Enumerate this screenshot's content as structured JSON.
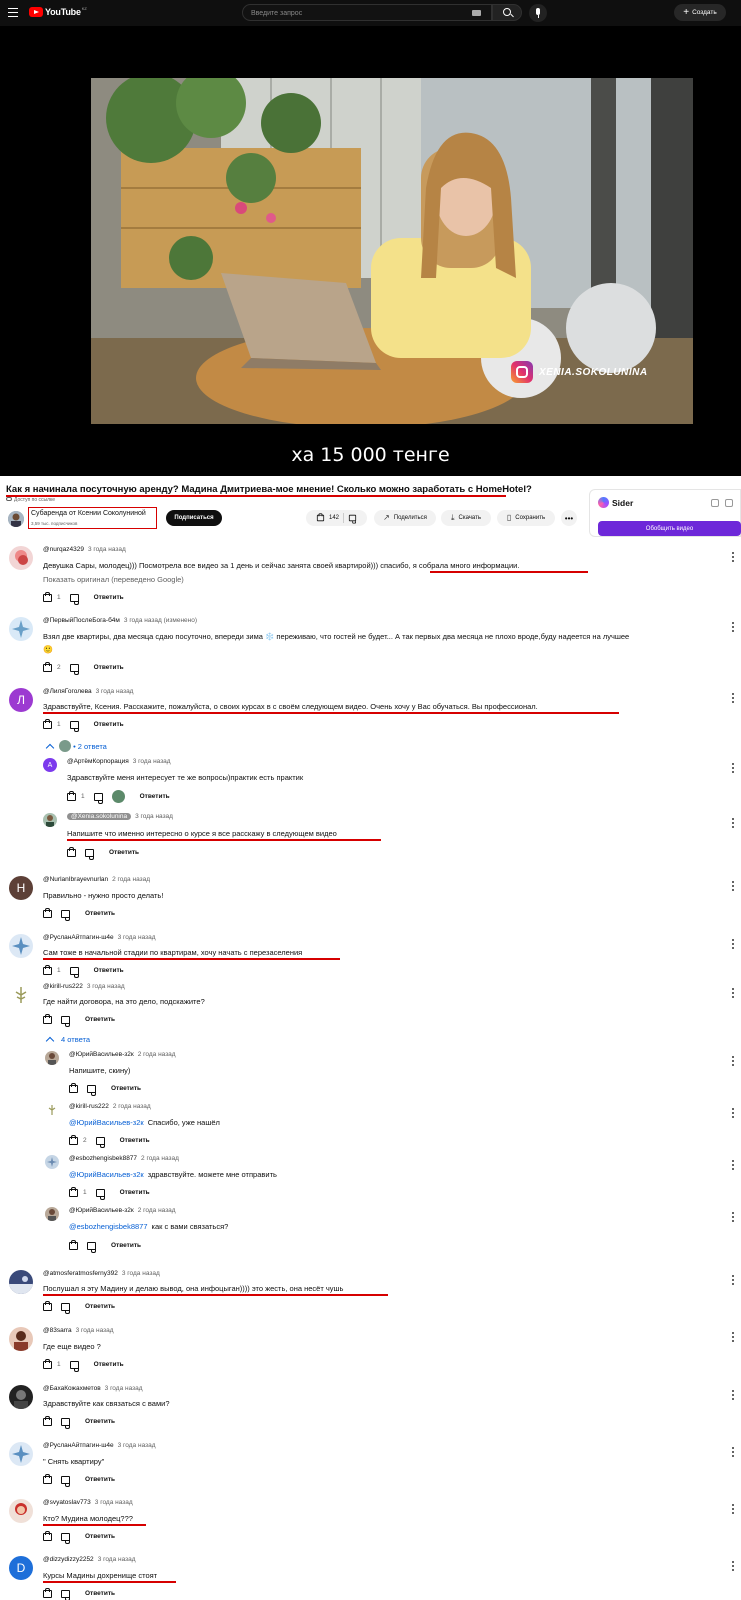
{
  "header": {
    "logo_text": "YouTube",
    "country_code": "KZ",
    "search_placeholder": "Введите запрос",
    "create_label": "Создать"
  },
  "video": {
    "subtitle": "ха 15 000 тенге",
    "watermark": "XENIA.SOKOLUNINA",
    "title": "Как я начинала посуточную аренду? Мадина Дмитриева-мое мнение! Сколько можно заработать с HomeHotel?",
    "access_note": "Доступ по ссылке",
    "channel_name": "Субаренда от Ксении Соколуниной",
    "channel_subs": "3,59 тыс. подписчиков",
    "subscribe_label": "Подписаться",
    "like_count": "142",
    "share_label": "Поделиться",
    "download_label": "Скачать",
    "save_label": "Сохранить"
  },
  "sider": {
    "name": "Sider",
    "button_label": "Обобщить видео"
  },
  "reply_label": "Ответить",
  "comments": [
    {
      "author": "@nurqaz4329",
      "time": "3 года назад",
      "text_a": "Девушка Сары, молодец))) Посмотрела все видео за 1 день и сейчас занята своей квартирой))) ",
      "text_b": "спасибо, я собрала много информации.",
      "translate": "Показать оригинал (переведено Google)",
      "likes": "1"
    },
    {
      "author": "@ПервыйПослеБога-б4м",
      "time": "3 года назад",
      "edited": "(изменено)",
      "text": "Взял две квартиры, два месяца сдаю посуточно, впереди зима ❄️ переживаю, что гостей не будет... А так первых два месяца не плохо вроде,буду надеется на лучшее",
      "emoji": "🙂",
      "likes": "2"
    },
    {
      "author": "@ЛиляГоголева",
      "time": "3 года назад",
      "avatar_letter": "Л",
      "text": "Здравствуйте, Ксения. Расскажите, пожалуйста, о своих курсах в с своём  следующем  видео. Очень  хочу  у Вас  обучаться. Вы профессионал.",
      "likes": "1",
      "replies_label": "2 ответа"
    },
    {
      "author": "@АртёмКорпорация",
      "time": "3 года назад",
      "avatar_letter": "А",
      "text": "Здравствуйте меня интересует те же вопросы)практик есть практик",
      "likes": "1"
    },
    {
      "author": "@Xenia.sokolunina",
      "time": "3 года назад",
      "text": "Напишите что именно интересно о курсе я все расскажу в следующем видео"
    },
    {
      "author": "@NurlanIbrayevnurlan",
      "time": "2 года назад",
      "avatar_letter": "Н",
      "text": "Правильно - нужно просто делать!"
    },
    {
      "author": "@РусланАйтпагин-ш4е",
      "time": "3 года назад",
      "text": "Сам тоже в начальной стадии по квартирам, хочу начать с перезаселения",
      "likes": "1"
    },
    {
      "author": "@kirill-rus222",
      "time": "3 года назад",
      "text": "Где найти договора, на это дело, подскажите?",
      "replies_label": "4 ответа"
    },
    {
      "author": "@ЮрийВасильев-з2к",
      "time": "2 года назад",
      "text": "Напишите, скину)"
    },
    {
      "author": "@kirill-rus222",
      "time": "2 года назад",
      "mention": "@ЮрийВасильев-з2к",
      "text": "Спасибо, уже нашёл",
      "likes": "2"
    },
    {
      "author": "@esbozhengisbek8877",
      "time": "2 года назад",
      "mention": "@ЮрийВасильев-з2к",
      "text": "здравствуйте. можете мне отправить",
      "likes": "1"
    },
    {
      "author": "@ЮрийВасильев-з2к",
      "time": "2 года назад",
      "mention": "@esbozhengisbek8877",
      "text": "как с вами связаться?"
    },
    {
      "author": "@atmosferatmosferny392",
      "time": "3 года назад",
      "text": "Послушал я эту Мадину и делаю вывод, она инфоцыган)))) это жесть, она несёт чушь"
    },
    {
      "author": "@83sarra",
      "time": "3 года назад",
      "text": "Где еще видео ?",
      "likes": "1"
    },
    {
      "author": "@БахаКожахметов",
      "time": "3 года назад",
      "text": "Здравствуйте как связаться с вами?"
    },
    {
      "author": "@РусланАйтпагин-ш4е",
      "time": "3 года назад",
      "text": "\" Снять квартиру\""
    },
    {
      "author": "@svyatoslav773",
      "time": "3 года назад",
      "text": "Кто? Мудина молодец???"
    },
    {
      "author": "@dizzydizzy2252",
      "time": "3 года назад",
      "avatar_letter": "D",
      "text": "Курсы Мадины дохренище стоят"
    }
  ],
  "colors": {
    "underline_red": "#d60000",
    "link_blue": "#065fd4",
    "sider_purple": "#6d28d9",
    "youtube_red": "#ff0000"
  }
}
